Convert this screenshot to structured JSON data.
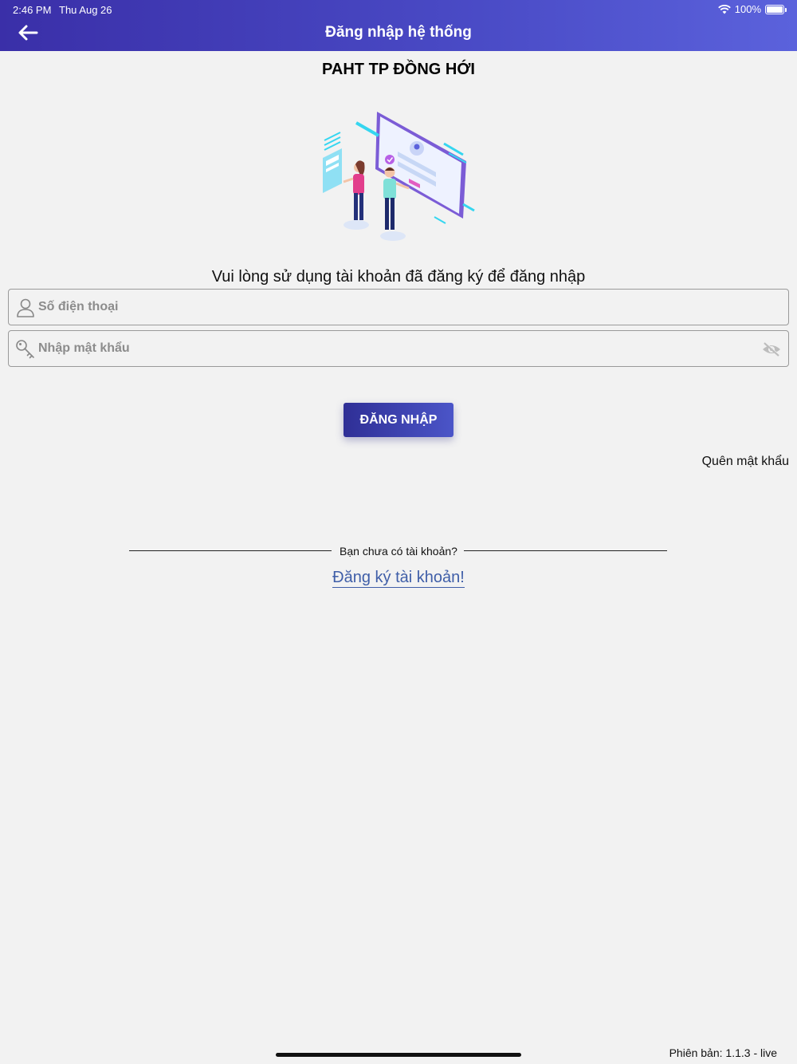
{
  "status_bar": {
    "time": "2:46 PM",
    "date": "Thu Aug 26",
    "battery": "100%"
  },
  "header": {
    "title": "Đăng nhập hệ thống"
  },
  "app_title": "PAHT TP ĐỒNG HỚI",
  "instruction": "Vui lòng sử dụng tài khoản đã đăng ký để đăng nhập",
  "form": {
    "phone_placeholder": "Số điện thoại",
    "password_placeholder": "Nhập mật khẩu",
    "login_label": "ĐĂNG NHẬP",
    "forgot_label": "Quên mật khẩu"
  },
  "signup": {
    "prompt": "Bạn chưa có tài khoản?",
    "link_label": "Đăng ký tài khoản!"
  },
  "footer": {
    "version": "Phiên bản: 1.1.3 - live"
  },
  "colors": {
    "header_gradient_start": "#3a2fa8",
    "header_gradient_end": "#5b62dc",
    "link": "#3f5ea8",
    "background": "#f2f2f2"
  }
}
